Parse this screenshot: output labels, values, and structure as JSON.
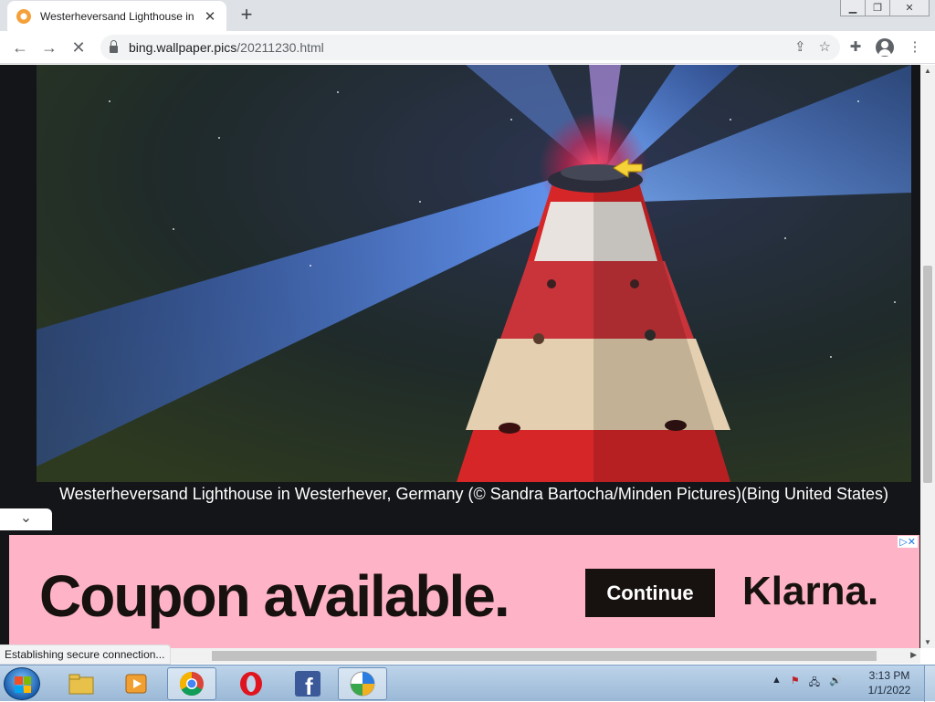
{
  "browser": {
    "tab_title": "Westerheversand Lighthouse in W",
    "tab_close_glyph": "✕",
    "new_tab_glyph": "+",
    "url_host": "bing.wallpaper.pics",
    "url_path": "/20211230.html",
    "status_text": "Establishing secure connection..."
  },
  "page": {
    "caption": "Westerheversand Lighthouse in Westerhever, Germany (© Sandra Bartocha/Minden Pictures)(Bing United States)",
    "collapse_glyph": "⌄"
  },
  "ad": {
    "headline": "Coupon available.",
    "cta_label": "Continue",
    "brand": "Klarna."
  },
  "taskbar": {
    "time": "3:13 PM",
    "date": "1/1/2022",
    "apps": [
      "file-explorer",
      "media-player",
      "chrome",
      "opera",
      "facebook",
      "app"
    ]
  },
  "colors": {
    "ad_background": "#ffb3c7",
    "ad_dark": "#17120f",
    "lighthouse_red": "#d8262a",
    "beam_blue": "#3a7bff"
  }
}
